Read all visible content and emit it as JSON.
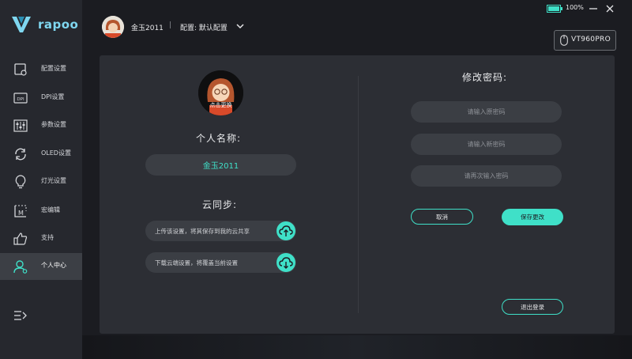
{
  "app": {
    "logo": "rapoo"
  },
  "header": {
    "username": "金玉2011",
    "separator": "|",
    "config": "配置: 默认配置",
    "battery": "100%",
    "device": "VT960PRO"
  },
  "sidebar": {
    "items": [
      {
        "label": "配置设置",
        "icon": "config-icon"
      },
      {
        "label": "DPI设置",
        "icon": "dpi-icon"
      },
      {
        "label": "参数设置",
        "icon": "sliders-icon"
      },
      {
        "label": "OLED设置",
        "icon": "refresh-icon"
      },
      {
        "label": "灯光设置",
        "icon": "bulb-icon"
      },
      {
        "label": "宏编辑",
        "icon": "macro-icon"
      },
      {
        "label": "支持",
        "icon": "thumbs-up-icon"
      },
      {
        "label": "个人中心",
        "icon": "user-icon",
        "active": true
      }
    ]
  },
  "profile": {
    "change_avatar": "点击更换",
    "name_title": "个人名称:",
    "name_value": "金玉2011",
    "sync_title": "云同步:",
    "upload_text": "上传该设置，将其保存到我的云共享",
    "download_text": "下载云端设置，将覆盖当前设置"
  },
  "password": {
    "title": "修改密码:",
    "old_placeholder": "请输入原密码",
    "new_placeholder": "请输入新密码",
    "confirm_placeholder": "请再次输入密码",
    "cancel": "取消",
    "save": "保存更改",
    "logout": "退出登录"
  },
  "colors": {
    "accent": "#3fe0c8",
    "panel": "#2c2e34",
    "sidebar": "#26282e"
  }
}
